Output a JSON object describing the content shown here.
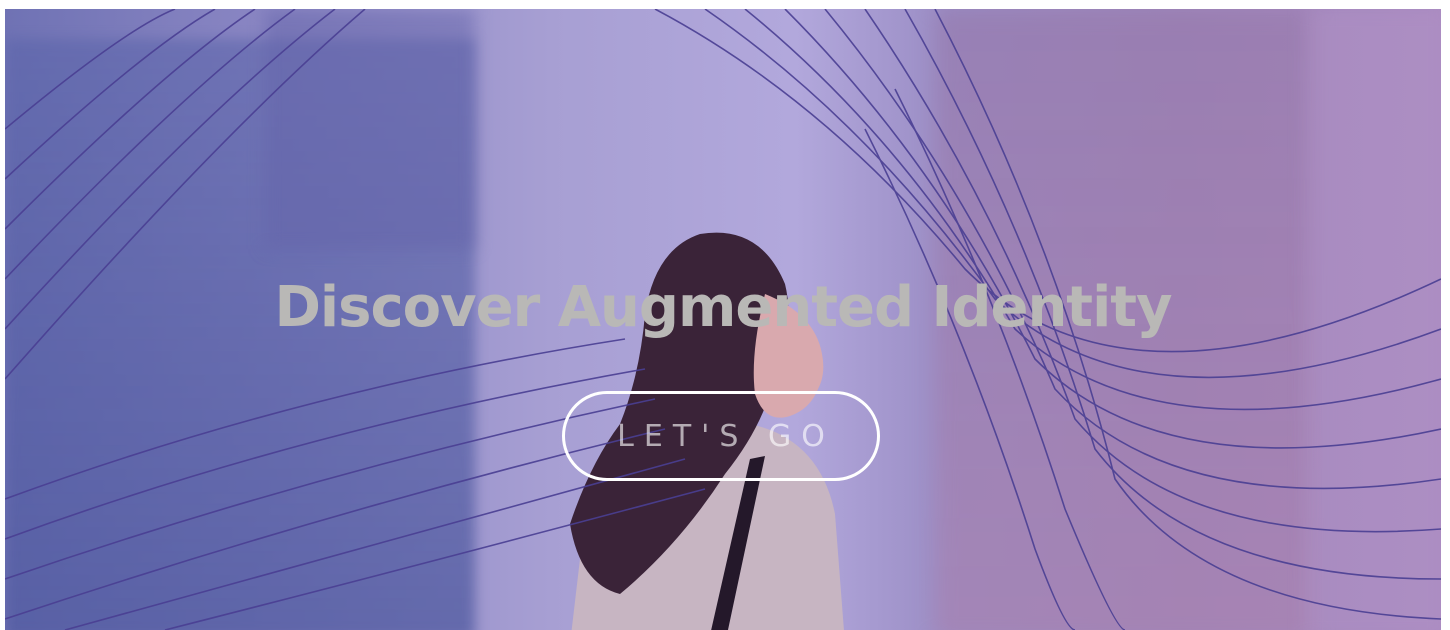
{
  "hero": {
    "headline": "Discover Augmented Identity",
    "cta_label": "LET'S GO"
  },
  "colors": {
    "overlay_purple": "#a79fd3",
    "line_color": "#4a3f93",
    "headline_color": "#b9b8b6",
    "button_border": "#ffffff"
  }
}
